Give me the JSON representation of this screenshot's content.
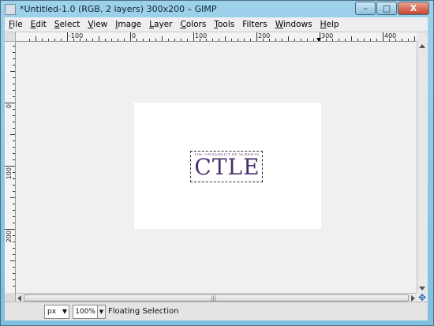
{
  "window": {
    "title": "*Untitled-1.0 (RGB, 2 layers) 300x200 – GIMP",
    "minimize_label": "–",
    "maximize_label": "□",
    "close_label": "X"
  },
  "menubar": [
    {
      "id": "file",
      "underline": "F",
      "rest": "ile"
    },
    {
      "id": "edit",
      "underline": "E",
      "rest": "dit"
    },
    {
      "id": "select",
      "underline": "S",
      "rest": "elect"
    },
    {
      "id": "view",
      "underline": "V",
      "rest": "iew"
    },
    {
      "id": "image",
      "underline": "I",
      "rest": "mage"
    },
    {
      "id": "layer",
      "underline": "L",
      "rest": "ayer"
    },
    {
      "id": "colors",
      "underline": "C",
      "rest": "olors"
    },
    {
      "id": "tools",
      "underline": "T",
      "rest": "ools"
    },
    {
      "id": "filters",
      "underline": "",
      "rest": "Filters"
    },
    {
      "id": "windows",
      "underline": "W",
      "rest": "indows"
    },
    {
      "id": "help",
      "underline": "H",
      "rest": "elp"
    }
  ],
  "rulers": {
    "horizontal_labels": [
      "-100",
      "0",
      "100",
      "200",
      "300",
      "400"
    ],
    "vertical_labels": [
      "0",
      "100",
      "200"
    ]
  },
  "canvas": {
    "logo_small_text": "THE UNIVERSITY OF SCRANTON",
    "logo_main_text": "CTLE",
    "logo_color": "#4b2e6f"
  },
  "statusbar": {
    "unit": "px",
    "zoom": "100%",
    "message": "Floating Selection"
  },
  "icons": {
    "navigate": "navigate-icon",
    "quick_mask": "quick-mask-icon"
  }
}
